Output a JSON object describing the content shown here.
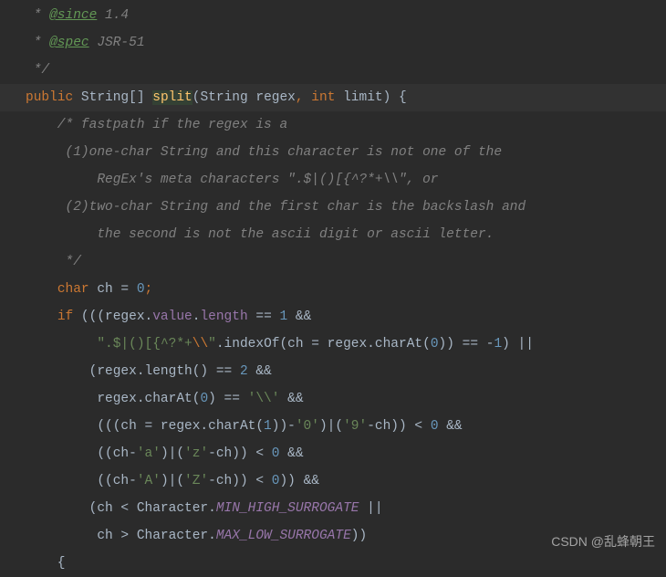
{
  "code": {
    "l1_indent": " * ",
    "l1_anno": "@since",
    "l1_rest": " 1.4",
    "l2_indent": " * ",
    "l2_anno": "@spec",
    "l2_rest": " JSR-51",
    "l3": " */",
    "sig_public": "public",
    "sig_space1": " ",
    "sig_type": "String[] ",
    "sig_method": "split",
    "sig_paren_open": "(",
    "sig_param1": "String regex",
    "sig_comma": ",",
    "sig_space2": " ",
    "sig_int": "int",
    "sig_param2": " limit",
    "sig_paren_close": ")",
    "sig_brace": " {",
    "c1": "    /* fastpath if the regex is a",
    "c2": "     (1)one-char String and this character is not one of the",
    "c3": "         RegEx's meta characters \".$|()[{^?*+\\\\\", or",
    "c4": "     (2)two-char String and the first char is the backslash and",
    "c5": "         the second is not the ascii digit or ascii letter.",
    "c6": "     */",
    "d1_indent": "    ",
    "d1_char": "char",
    "d1_rest1": " ch = ",
    "d1_zero": "0",
    "d1_semi": ";",
    "d2_indent": "    ",
    "d2_if": "if",
    "d2_rest1": " (((regex.",
    "d2_value": "value",
    "d2_dot": ".",
    "d2_length": "length",
    "d2_eq": " == ",
    "d2_one": "1",
    "d2_and": " &&",
    "d3_indent": "         ",
    "d3_str": "\".$|()[{^?*+",
    "d3_esc": "\\\\",
    "d3_strend": "\"",
    "d3_rest1": ".indexOf(ch = regex.charAt(",
    "d3_zero": "0",
    "d3_rest2": ")) == -",
    "d3_one": "1",
    "d3_rest3": ") ||",
    "d4_indent": "        (regex.length() == ",
    "d4_two": "2",
    "d4_and": " &&",
    "d5_indent": "         regex.charAt(",
    "d5_zero": "0",
    "d5_rest1": ") == ",
    "d5_char": "'\\\\'",
    "d5_and": " &&",
    "d6_indent": "         (((ch = regex.charAt(",
    "d6_one": "1",
    "d6_rest1": "))-",
    "d6_ch0": "'0'",
    "d6_rest2": ")|(",
    "d6_ch9": "'9'",
    "d6_rest3": "-ch)) < ",
    "d6_zero": "0",
    "d6_and": " &&",
    "d7_indent": "         ((ch-",
    "d7_cha": "'a'",
    "d7_rest1": ")|(",
    "d7_chz": "'z'",
    "d7_rest2": "-ch)) < ",
    "d7_zero": "0",
    "d7_and": " &&",
    "d8_indent": "         ((ch-",
    "d8_chA": "'A'",
    "d8_rest1": ")|(",
    "d8_chZ": "'Z'",
    "d8_rest2": "-ch)) < ",
    "d8_zero": "0",
    "d8_rest3": ")) &&",
    "d9_rest1": "        (ch < Character.",
    "d9_const": "MIN_HIGH_SURROGATE",
    "d9_rest2": " ||",
    "d10_rest1": "         ch > Character.",
    "d10_const": "MAX_LOW_SURROGATE",
    "d10_rest2": "))",
    "d11": "    {"
  },
  "watermark": "CSDN @乱蜂朝王"
}
